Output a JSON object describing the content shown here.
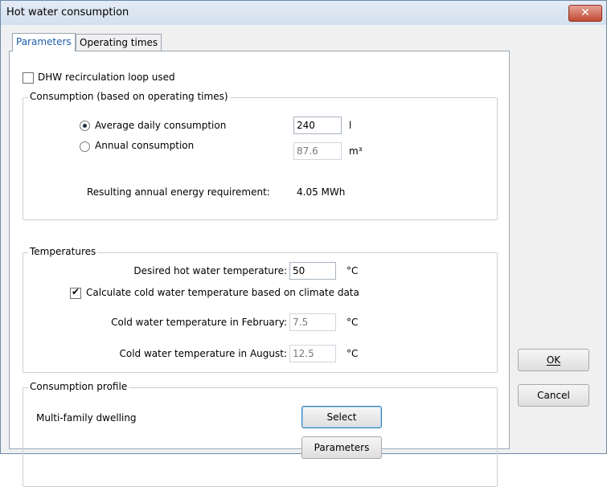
{
  "window": {
    "title": "Hot water consumption",
    "close_label": "✕"
  },
  "tabs": [
    {
      "label": "Parameters",
      "active": true
    },
    {
      "label": "Operating times",
      "active": false
    }
  ],
  "recirculation": {
    "label": "DHW recirculation loop used",
    "checked": false
  },
  "consumption": {
    "group_label": "Consumption (based on operating times)",
    "daily": {
      "label": "Average daily consumption",
      "value": "240",
      "unit": "l",
      "selected": true
    },
    "annual": {
      "label": "Annual consumption",
      "value": "87.6",
      "unit": "m³",
      "selected": false
    },
    "energy_label": "Resulting annual energy requirement:",
    "energy_value": "4.05 MWh"
  },
  "temperatures": {
    "group_label": "Temperatures",
    "desired": {
      "label": "Desired hot water temperature:",
      "value": "50",
      "unit": "°C"
    },
    "calc_checkbox": {
      "label": "Calculate cold water temperature based on climate data",
      "checked": true
    },
    "february": {
      "label": "Cold water temperature in February:",
      "value": "7.5",
      "unit": "°C"
    },
    "august": {
      "label": "Cold water temperature in August:",
      "value": "12.5",
      "unit": "°C"
    }
  },
  "profile": {
    "group_label": "Consumption profile",
    "name": "Multi-family dwelling",
    "select_label": "Select",
    "parameters_label": "Parameters"
  },
  "buttons": {
    "ok": "OK",
    "cancel": "Cancel"
  }
}
